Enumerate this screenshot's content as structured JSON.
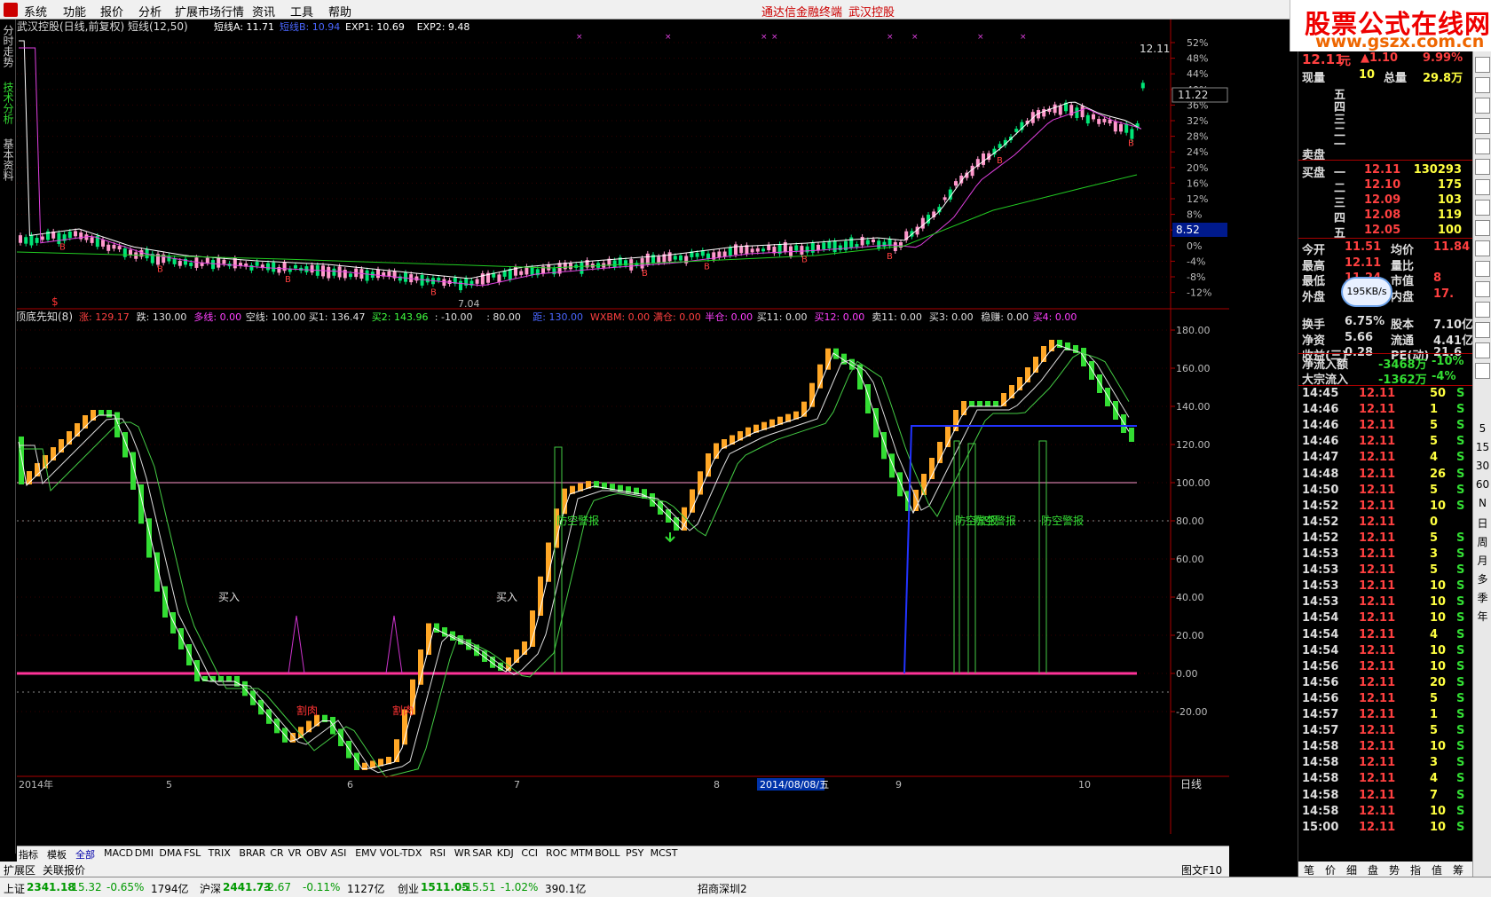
{
  "menu": {
    "items": [
      "系统",
      "功能",
      "报价",
      "分析",
      "扩展市场行情",
      "资讯",
      "工具",
      "帮助"
    ],
    "center_title": "通达信金融终端",
    "stock_title": "武汉控股"
  },
  "brand": {
    "line1": "股票公式在线网",
    "line2": "www.gszx.com.cn"
  },
  "left_tabs": [
    "分时走势",
    "技术分析",
    "基本资料"
  ],
  "main_chart": {
    "header": "武汉控股(日线,前复权) 短线(12,50)",
    "legend": [
      {
        "label": "短线A: 11.71",
        "color": "#ffffff"
      },
      {
        "label": "短线B: 10.94",
        "color": "#4a66ff"
      },
      {
        "label": "EXP1: 10.69",
        "color": "#ffffff"
      },
      {
        "label": "EXP2: 9.48",
        "color": "#ffffff"
      }
    ],
    "price_high_label": "12.11",
    "price_line_label": "11.22",
    "axis_marker": "8.52",
    "low_label": "7.04",
    "signal_mark": "$",
    "y_axis": [
      "52%",
      "48%",
      "44%",
      "40%",
      "36%",
      "32%",
      "28%",
      "24%",
      "20%",
      "16%",
      "12%",
      "8%",
      "4%",
      "0%",
      "-4%",
      "-8%",
      "-12%"
    ]
  },
  "indicator": {
    "header": "顶底先知(8)",
    "legend": [
      {
        "label": "涨: 129.17",
        "color": "#ff4040"
      },
      {
        "label": "跌: 130.00",
        "color": "#e0e0e0"
      },
      {
        "label": "多线: 0.00",
        "color": "#ff40ff"
      },
      {
        "label": "空线: 100.00",
        "color": "#e0e0e0"
      },
      {
        "label": "买1: 136.47",
        "color": "#e0e0e0"
      },
      {
        "label": "买2: 143.96",
        "color": "#40ff40"
      },
      {
        "label": ": -10.00",
        "color": "#e0e0e0"
      },
      {
        "label": ": 80.00",
        "color": "#e0e0e0"
      },
      {
        "label": "距: 130.00",
        "color": "#4a66ff"
      },
      {
        "label": "WXBM: 0.00",
        "color": "#ff4040"
      },
      {
        "label": "满仓: 0.00",
        "color": "#ff4040"
      },
      {
        "label": "半仓: 0.00",
        "color": "#ff40ff"
      },
      {
        "label": "买11: 0.00",
        "color": "#e0e0e0"
      },
      {
        "label": "买12: 0.00",
        "color": "#ff40ff"
      },
      {
        "label": "卖11: 0.00",
        "color": "#e0e0e0"
      },
      {
        "label": "买3: 0.00",
        "color": "#e0e0e0"
      },
      {
        "label": "稳赚: 0.00",
        "color": "#e0e0e0"
      },
      {
        "label": "买4: 0.00",
        "color": "#ff40ff"
      }
    ],
    "y_axis": [
      "180.00",
      "160.00",
      "140.00",
      "120.00",
      "100.00",
      "80.00",
      "60.00",
      "40.00",
      "20.00",
      "0.00",
      "-20.00"
    ],
    "buy_label": "买入",
    "alarm_label": "防空警报",
    "sell_label": "割肉"
  },
  "date_axis": {
    "labels": [
      "2014年",
      "5",
      "6",
      "7",
      "8",
      "9",
      "10"
    ],
    "selected_date": "2014/08/08/五",
    "period": "日线"
  },
  "quote": {
    "price": "12.11",
    "unit": "元",
    "change": "▲1.10",
    "pct": "9.99%",
    "now_vol_label": "现量",
    "now_vol": "10",
    "total_vol_label": "总量",
    "total_vol": "29.8万",
    "sell_label": "卖盘",
    "buy_label": "买盘",
    "sell_levels": [
      "五",
      "四",
      "三",
      "二",
      "一"
    ],
    "buy_levels": [
      {
        "lvl": "一",
        "price": "12.11",
        "vol": "130293"
      },
      {
        "lvl": "二",
        "price": "12.10",
        "vol": "175"
      },
      {
        "lvl": "三",
        "price": "12.09",
        "vol": "103"
      },
      {
        "lvl": "四",
        "price": "12.08",
        "vol": "119"
      },
      {
        "lvl": "五",
        "price": "12.05",
        "vol": "100"
      }
    ],
    "stats": [
      {
        "l1": "今开",
        "v1": "11.51",
        "l2": "均价",
        "v2": "11.84"
      },
      {
        "l1": "最高",
        "v1": "12.11",
        "l2": "量比",
        "v2": ""
      },
      {
        "l1": "最低",
        "v1": "11.24",
        "l2": "市值",
        "v2": "8"
      },
      {
        "l1": "外盘",
        "v1": "12.6万",
        "l2": "内盘",
        "v2": "17."
      },
      {
        "l1": "换手",
        "v1": "6.75%",
        "l2": "股本",
        "v2": "7.10亿"
      },
      {
        "l1": "净资",
        "v1": "5.66",
        "l2": "流通",
        "v2": "4.41亿"
      },
      {
        "l1": "收益(三)",
        "v1": "0.28",
        "l2": "PE(动)",
        "v2": "21.6"
      }
    ],
    "flow1_label": "净流入额",
    "flow1_val": "-3468万",
    "flow1_pct": "-10%",
    "flow2_label": "大宗流入",
    "flow2_val": "-1362万",
    "flow2_pct": "-4%",
    "speed": "195KB/s"
  },
  "ticks": [
    {
      "t": "14:45",
      "p": "12.11",
      "v": "50",
      "s": "S"
    },
    {
      "t": "14:46",
      "p": "12.11",
      "v": "1",
      "s": "S"
    },
    {
      "t": "14:46",
      "p": "12.11",
      "v": "5",
      "s": "S"
    },
    {
      "t": "14:46",
      "p": "12.11",
      "v": "5",
      "s": "S"
    },
    {
      "t": "14:47",
      "p": "12.11",
      "v": "4",
      "s": "S"
    },
    {
      "t": "14:48",
      "p": "12.11",
      "v": "26",
      "s": "S"
    },
    {
      "t": "14:50",
      "p": "12.11",
      "v": "5",
      "s": "S"
    },
    {
      "t": "14:52",
      "p": "12.11",
      "v": "10",
      "s": "S"
    },
    {
      "t": "14:52",
      "p": "12.11",
      "v": "0",
      "s": ""
    },
    {
      "t": "14:52",
      "p": "12.11",
      "v": "5",
      "s": "S"
    },
    {
      "t": "14:53",
      "p": "12.11",
      "v": "3",
      "s": "S"
    },
    {
      "t": "14:53",
      "p": "12.11",
      "v": "5",
      "s": "S"
    },
    {
      "t": "14:53",
      "p": "12.11",
      "v": "10",
      "s": "S"
    },
    {
      "t": "14:53",
      "p": "12.11",
      "v": "10",
      "s": "S"
    },
    {
      "t": "14:54",
      "p": "12.11",
      "v": "10",
      "s": "S"
    },
    {
      "t": "14:54",
      "p": "12.11",
      "v": "4",
      "s": "S"
    },
    {
      "t": "14:54",
      "p": "12.11",
      "v": "10",
      "s": "S"
    },
    {
      "t": "14:56",
      "p": "12.11",
      "v": "10",
      "s": "S"
    },
    {
      "t": "14:56",
      "p": "12.11",
      "v": "20",
      "s": "S"
    },
    {
      "t": "14:56",
      "p": "12.11",
      "v": "5",
      "s": "S"
    },
    {
      "t": "14:57",
      "p": "12.11",
      "v": "1",
      "s": "S"
    },
    {
      "t": "14:57",
      "p": "12.11",
      "v": "5",
      "s": "S"
    },
    {
      "t": "14:58",
      "p": "12.11",
      "v": "10",
      "s": "S"
    },
    {
      "t": "14:58",
      "p": "12.11",
      "v": "3",
      "s": "S"
    },
    {
      "t": "14:58",
      "p": "12.11",
      "v": "4",
      "s": "S"
    },
    {
      "t": "14:58",
      "p": "12.11",
      "v": "7",
      "s": "S"
    },
    {
      "t": "14:58",
      "p": "12.11",
      "v": "10",
      "s": "S"
    },
    {
      "t": "15:00",
      "p": "12.11",
      "v": "10",
      "s": "S"
    }
  ],
  "right_tabs": [
    "笔",
    "价",
    "细",
    "盘",
    "势",
    "指",
    "值",
    "筹"
  ],
  "side_icons": [
    "chart-icon",
    "grid-icon",
    "line-icon",
    "bar-icon",
    "f10-icon",
    "info-icon",
    "calendar-icon",
    "f12-icon",
    "f9-icon",
    "magnifier-icon",
    "chart2-icon",
    "si-icon",
    "plus-icon",
    "pencil-icon",
    "f5-icon",
    "clock-icon"
  ],
  "side_labels": [
    "5",
    "15",
    "30",
    "60",
    "N",
    "日",
    "周",
    "月",
    "多",
    "季",
    "年"
  ],
  "bottom_tabs": [
    "指标",
    "模板",
    "全部",
    "MACD",
    "DMI",
    "DMA",
    "FSL",
    "TRIX",
    "BRAR",
    "CR",
    "VR",
    "OBV",
    "ASI",
    "EMV",
    "VOL-TDX",
    "RSI",
    "WR",
    "SAR",
    "KDJ",
    "CCI",
    "ROC",
    "MTM",
    "BOLL",
    "PSY",
    "MCST"
  ],
  "extbar": {
    "ext": "扩展区",
    "quote": "关联报价",
    "fig": "图文F10"
  },
  "status": [
    {
      "name": "上证",
      "val": "2341.18",
      "chg": "-15.32",
      "pct": "-0.65%",
      "amt": "1794亿"
    },
    {
      "name": "沪深",
      "val": "2441.73",
      "chg": "-2.67",
      "pct": "-0.11%",
      "amt": "1127亿"
    },
    {
      "name": "创业",
      "val": "1511.05",
      "chg": "-15.51",
      "pct": "-1.02%",
      "amt": "390.1亿"
    }
  ],
  "server": "招商深圳2",
  "colors": {
    "up": "#ff4040",
    "down": "#00e676",
    "bull": "#ff99cc",
    "indicator_up": "#ffa726",
    "indicator_down": "#33dd33",
    "magenta": "#ff3399",
    "blue": "#2233ff"
  }
}
